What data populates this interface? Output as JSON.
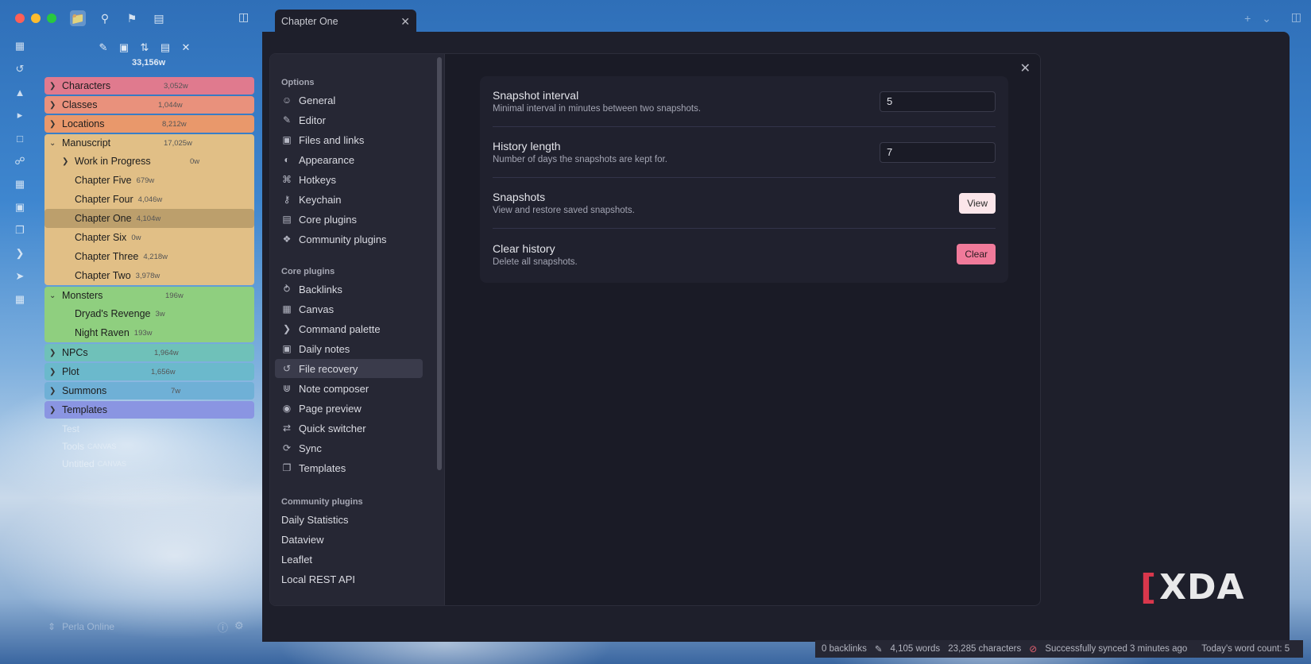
{
  "sidebar": {
    "vault_word_count": "33,156w",
    "vault_name": "Perla Online",
    "folders": [
      {
        "label": "Characters",
        "count": "3,052w"
      },
      {
        "label": "Classes",
        "count": "1,044w"
      },
      {
        "label": "Locations",
        "count": "8,212w"
      },
      {
        "label": "Manuscript",
        "count": "17,025w",
        "children": [
          {
            "label": "Work in Progress",
            "count": "0w"
          },
          {
            "label": "Chapter Five",
            "count": "679w"
          },
          {
            "label": "Chapter Four",
            "count": "4,046w"
          },
          {
            "label": "Chapter One",
            "count": "4,104w"
          },
          {
            "label": "Chapter Six",
            "count": "0w"
          },
          {
            "label": "Chapter Three",
            "count": "4,218w"
          },
          {
            "label": "Chapter Two",
            "count": "3,978w"
          }
        ]
      },
      {
        "label": "Monsters",
        "count": "196w",
        "children": [
          {
            "label": "Dryad's Revenge",
            "count": "3w"
          },
          {
            "label": "Night Raven",
            "count": "193w"
          }
        ]
      },
      {
        "label": "NPCs",
        "count": "1,964w"
      },
      {
        "label": "Plot",
        "count": "1,656w"
      },
      {
        "label": "Summons",
        "count": "7w"
      },
      {
        "label": "Templates",
        "count": ""
      }
    ],
    "loose_files": [
      {
        "label": "Test",
        "tag": ""
      },
      {
        "label": "Tools",
        "tag": "CANVAS"
      },
      {
        "label": "Untitled",
        "tag": "CANVAS"
      }
    ]
  },
  "tab": {
    "title": "Chapter One"
  },
  "settings_nav": {
    "options_heading": "Options",
    "options": [
      "General",
      "Editor",
      "Files and links",
      "Appearance",
      "Hotkeys",
      "Keychain",
      "Core plugins",
      "Community plugins"
    ],
    "core_heading": "Core plugins",
    "core": [
      "Backlinks",
      "Canvas",
      "Command palette",
      "Daily notes",
      "File recovery",
      "Note composer",
      "Page preview",
      "Quick switcher",
      "Sync",
      "Templates"
    ],
    "community_heading": "Community plugins",
    "community": [
      "Daily Statistics",
      "Dataview",
      "Leaflet",
      "Local REST API"
    ]
  },
  "file_recovery": {
    "snapshot_interval": {
      "label": "Snapshot interval",
      "desc": "Minimal interval in minutes between two snapshots.",
      "value": "5"
    },
    "history_length": {
      "label": "History length",
      "desc": "Number of days the snapshots are kept for.",
      "value": "7"
    },
    "snapshots": {
      "label": "Snapshots",
      "desc": "View and restore saved snapshots.",
      "button": "View"
    },
    "clear_history": {
      "label": "Clear history",
      "desc": "Delete all snapshots.",
      "button": "Clear"
    }
  },
  "status_bar": {
    "backlinks": "0 backlinks",
    "words": "4,105 words",
    "characters": "23,285 characters",
    "sync": "Successfully synced 3 minutes ago",
    "today": "Today's word count: 5"
  },
  "watermark": "XDA",
  "colors": {
    "accent_pink": "#f07a9a",
    "modal_bg": "#1a1b26",
    "nav_bg": "#262734"
  }
}
